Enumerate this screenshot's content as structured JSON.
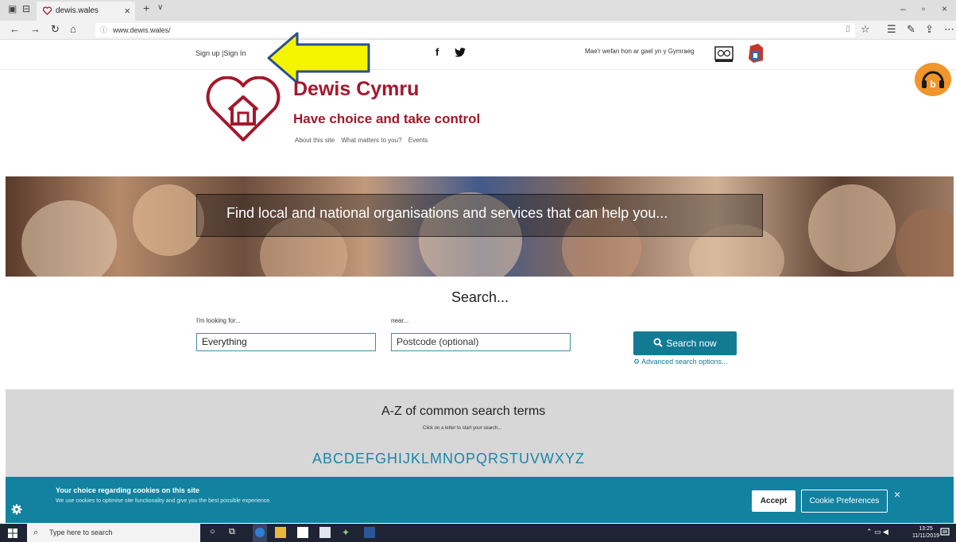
{
  "browser": {
    "tab_title": "dewis.wales",
    "tab_close": "×",
    "new_tab": "+",
    "tab_menu": "∨",
    "url": "www.dewis.wales/",
    "window_controls": [
      "–",
      "▫",
      "×"
    ]
  },
  "topbar": {
    "signin": "Sign up |Sign In",
    "facebook": "f",
    "welsh_notice": "Mae'r wefan hon ar gael yn y Gymraeg"
  },
  "brand": {
    "name": "Dewis Cymru",
    "tagline": "Have choice and take control",
    "nav": [
      "About this site",
      "What matters to you?",
      "Events"
    ]
  },
  "hero": {
    "text": "Find local and national organisations and services that can help you..."
  },
  "search": {
    "title": "Search...",
    "looking_label": "I'm looking for...",
    "looking_value": "Everything",
    "near_label": "near...",
    "near_placeholder": "Postcode (optional)",
    "button": "Search now",
    "advanced": "Advanced search options..."
  },
  "az": {
    "title": "A-Z of common search terms",
    "subtitle": "Click on a letter to start your search...",
    "letters": "ABCDEFGHIJKLMNOPQRSTUVWXYZ"
  },
  "cookie": {
    "title": "Your choice regarding cookies on this site",
    "text": "We use cookies to optimise site functionality and give you the best possible experience.",
    "accept": "Accept",
    "preferences": "Cookie Preferences",
    "close": "×"
  },
  "taskbar": {
    "search_placeholder": "Type here to search",
    "time": "13:25",
    "date": "11/11/2019"
  },
  "colors": {
    "brand_red": "#a5172b",
    "accent_teal": "#137a94",
    "listen_orange": "#f0962b",
    "arrow_yellow": "#f5f500"
  }
}
